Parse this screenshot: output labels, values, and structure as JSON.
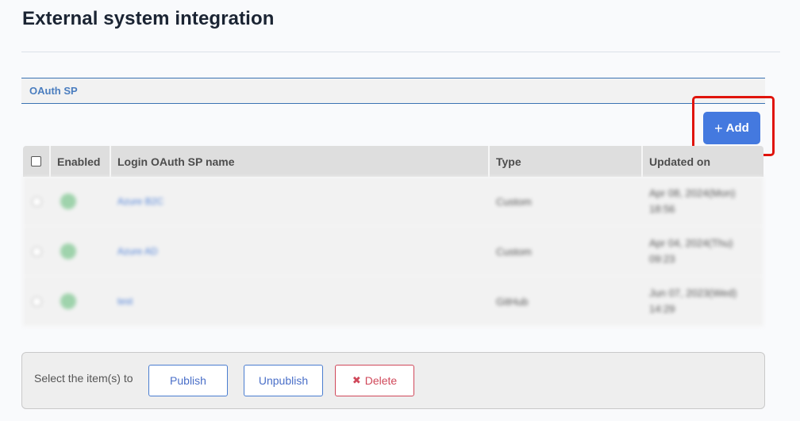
{
  "page": {
    "title": "External system integration"
  },
  "section": {
    "label": "OAuth SP"
  },
  "toolbar": {
    "add_icon": "plus-icon",
    "add_plus": "+",
    "add_label": "Add"
  },
  "table": {
    "columns": [
      "Enabled",
      "Login OAuth SP name",
      "Type",
      "Updated on"
    ],
    "rows": [
      {
        "enabled": true,
        "name": "Azure B2C",
        "type": "Custom",
        "updated_on": "Apr 08, 2024(Mon) 18:56"
      },
      {
        "enabled": true,
        "name": "Azure AD",
        "type": "Custom",
        "updated_on": "Apr 04, 2024(Thu) 09:23"
      },
      {
        "enabled": true,
        "name": "test",
        "type": "GitHub",
        "updated_on": "Jun 07, 2023(Wed) 14:29"
      }
    ]
  },
  "bulk_actions": {
    "label": "Select the item(s) to",
    "publish_label": "Publish",
    "unpublish_label": "Unpublish",
    "delete_icon": "x-icon",
    "delete_glyph": "✖",
    "delete_label": "Delete"
  },
  "colors": {
    "accent": "#4479df",
    "section_text": "#4a7dbf",
    "delete": "#d0485a",
    "highlight": "#e0140c",
    "enabled_dot": "#9fd3ac"
  }
}
